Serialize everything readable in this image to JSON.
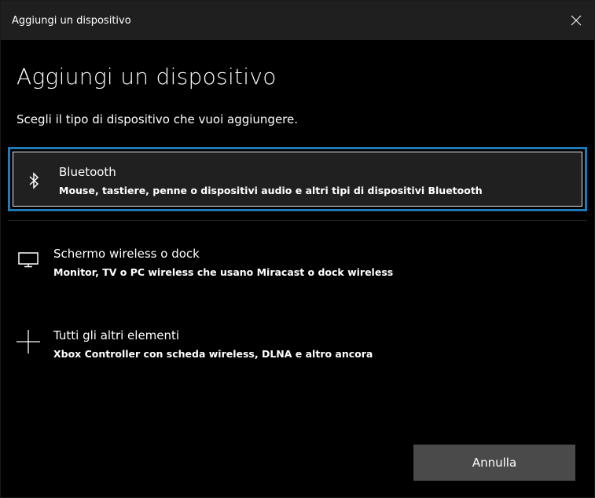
{
  "window": {
    "title": "Aggiungi un dispositivo"
  },
  "heading": "Aggiungi un dispositivo",
  "subtitle": "Scegli il tipo di dispositivo che vuoi aggiungere.",
  "options": [
    {
      "icon": "bluetooth-icon",
      "title": "Bluetooth",
      "description": "Mouse, tastiere, penne o dispositivi audio e altri tipi di dispositivi Bluetooth",
      "selected": true
    },
    {
      "icon": "monitor-icon",
      "title": "Schermo wireless o dock",
      "description": "Monitor, TV o PC wireless che usano Miracast o dock wireless",
      "selected": false
    },
    {
      "icon": "plus-icon",
      "title": "Tutti gli altri elementi",
      "description": "Xbox Controller con scheda wireless, DLNA e altro ancora",
      "selected": false
    }
  ],
  "buttons": {
    "cancel_label": "Annulla"
  },
  "colors": {
    "background": "#000000",
    "titlebar": "#1f1f1f",
    "selection_border": "#1f7ab7",
    "button": "#4a4a4a"
  }
}
